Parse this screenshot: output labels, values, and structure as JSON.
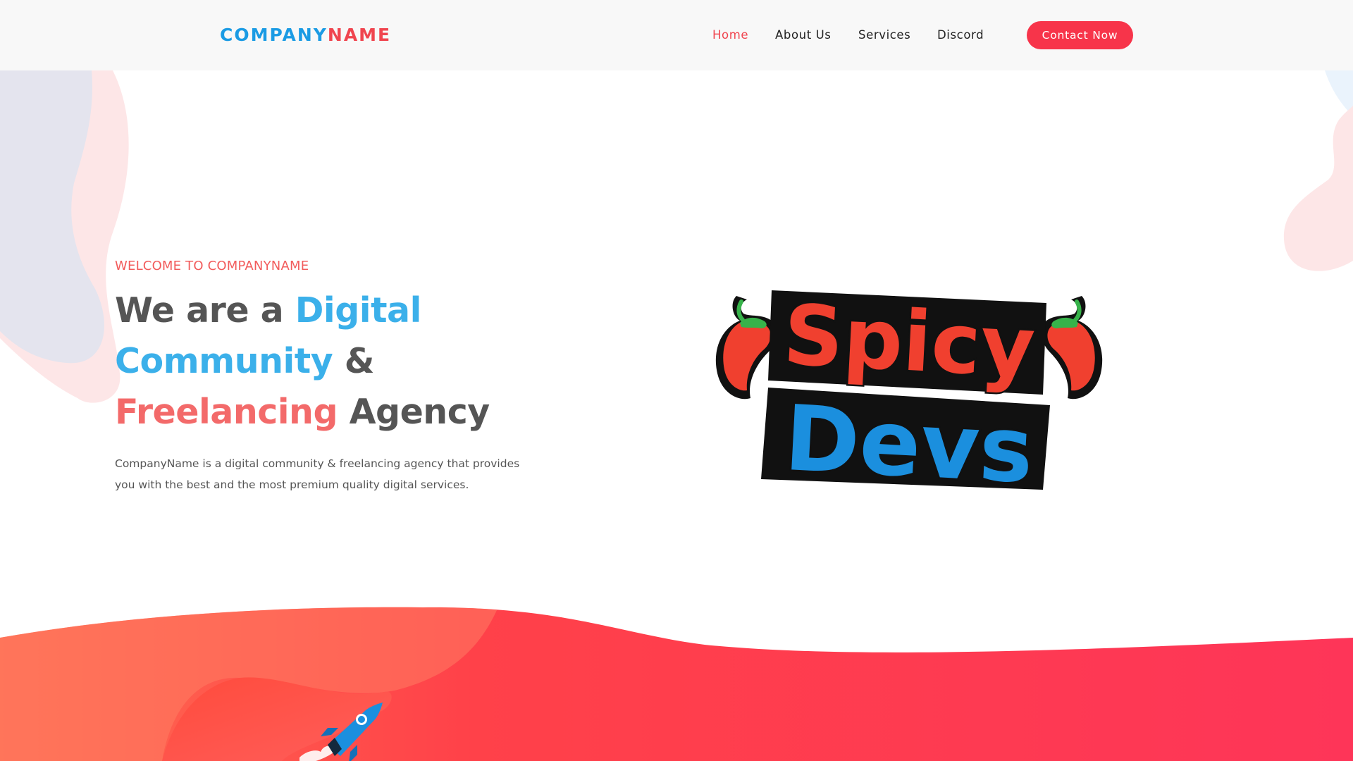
{
  "brand": {
    "name_part1": "COMPANY",
    "name_part2": "NAME",
    "colors": {
      "blue": "#1b9be4",
      "red": "#f0454f"
    }
  },
  "nav": {
    "items": [
      {
        "label": "Home",
        "active": true
      },
      {
        "label": "About Us",
        "active": false
      },
      {
        "label": "Services",
        "active": false
      },
      {
        "label": "Discord",
        "active": false
      }
    ],
    "cta_label": "Contact Now"
  },
  "hero": {
    "welcome": "WELCOME TO COMPANYNAME",
    "headline": {
      "w1": "We are a ",
      "w2": "Digital",
      "w3": "Community",
      "w4": " &",
      "w5": "Freelancing",
      "w6": " Agency"
    },
    "description": "CompanyName is a digital community & freelancing agency that provides you with the best and the most premium quality digital services."
  },
  "artwork": {
    "logo_word1": "Spicy",
    "logo_word2": "Devs",
    "icons": [
      "chili-pepper-icon",
      "chili-pepper-icon",
      "rocket-icon"
    ]
  }
}
